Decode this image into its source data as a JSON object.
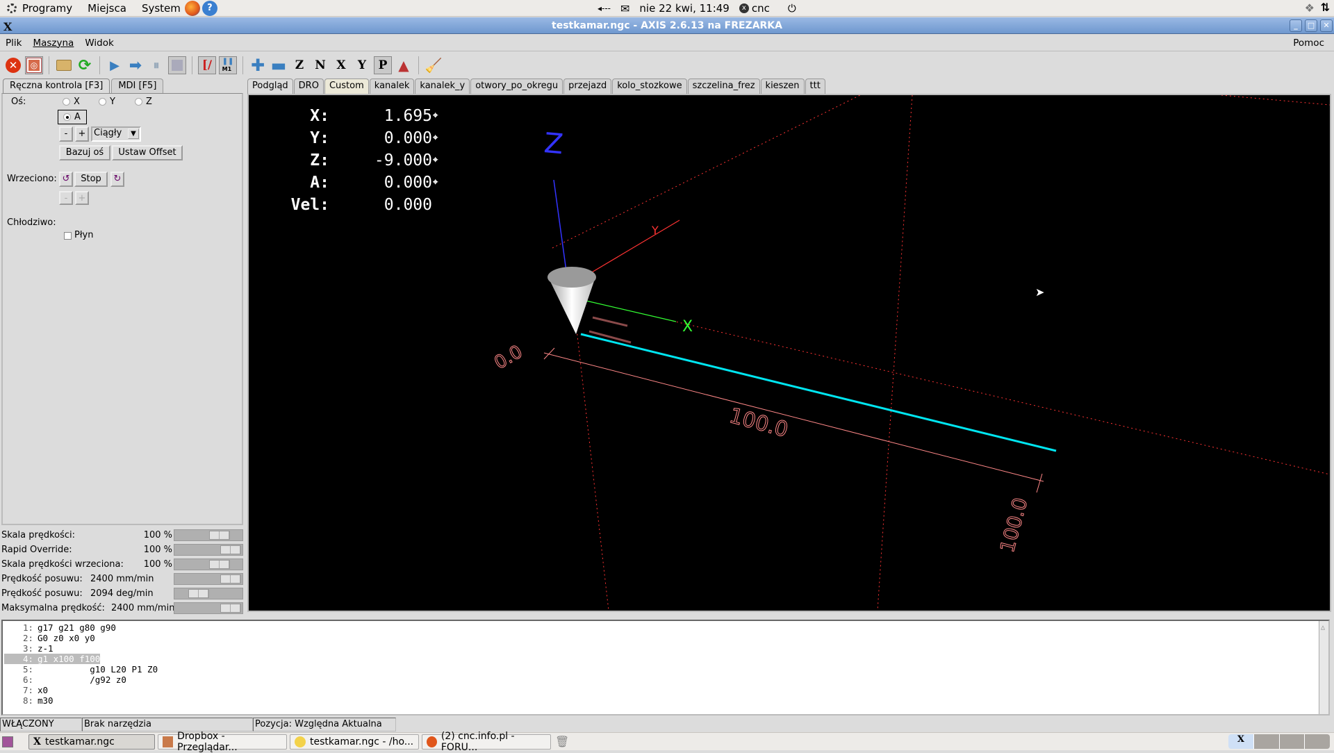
{
  "top_panel": {
    "menus": [
      "Programy",
      "Miejsca",
      "System"
    ],
    "clock": "nie 22 kwi, 11:49",
    "user": "cnc",
    "volume_indicator": "◂---"
  },
  "window": {
    "title": "testkamar.ngc - AXIS 2.6.13 na FREZARKA"
  },
  "menubar": {
    "items": [
      "Plik",
      "Maszyna",
      "Widok"
    ],
    "help": "Pomoc"
  },
  "toolbar": {
    "buttons": [
      "estop",
      "machine-power",
      "open-file",
      "reload-file",
      "run",
      "step",
      "pause",
      "stop",
      "block-delete",
      "optional-stop-m1",
      "zoom-in",
      "zoom-out",
      "view-z",
      "view-z-rotated",
      "view-x",
      "view-y",
      "view-perspective",
      "rotate-view",
      "clear-plot"
    ]
  },
  "left_tabs": [
    {
      "label": "Ręczna kontrola [F3]",
      "active": true
    },
    {
      "label": "MDI [F5]",
      "active": false
    }
  ],
  "manual": {
    "axis_label": "Oś:",
    "axes": [
      {
        "label": "X",
        "selected": false
      },
      {
        "label": "Y",
        "selected": false
      },
      {
        "label": "Z",
        "selected": false
      },
      {
        "label": "A",
        "selected": true
      }
    ],
    "jog_minus": "-",
    "jog_plus": "+",
    "jog_mode": "Ciągły",
    "home_button": "Bazuj oś",
    "offset_button": "Ustaw Offset",
    "spindle_label": "Wrzeciono:",
    "spindle_stop": "Stop",
    "spindle_minus": "-",
    "spindle_plus": "+",
    "coolant_label": "Chłodziwo:",
    "flood_label": "Płyn",
    "flood_checked": false
  },
  "sliders": [
    {
      "label": "Skala prędkości:",
      "value": "100 %",
      "fraction": 0.75
    },
    {
      "label": "Rapid Override:",
      "value": "100 %",
      "fraction": 1.0
    },
    {
      "label": "Skala prędkości wrzeciona:",
      "value": "100 %",
      "fraction": 0.75
    },
    {
      "label": "Prędkość posuwu:",
      "value": "2400 mm/min",
      "fraction": 1.0
    },
    {
      "label": "Prędkość posuwu:",
      "value": "2094 deg/min",
      "fraction": 0.3
    },
    {
      "label": "Maksymalna prędkość:",
      "value": "2400 mm/min",
      "fraction": 1.0
    }
  ],
  "view_tabs": [
    {
      "label": "Podgląd",
      "active": true
    },
    {
      "label": "DRO"
    },
    {
      "label": "Custom",
      "highlight": true
    },
    {
      "label": "kanalek"
    },
    {
      "label": "kanalek_y"
    },
    {
      "label": "otwory_po_okregu"
    },
    {
      "label": "przejazd"
    },
    {
      "label": "kolo_stozkowe"
    },
    {
      "label": "szczelina_frez"
    },
    {
      "label": "kieszen"
    },
    {
      "label": "ttt"
    }
  ],
  "dro": [
    {
      "axis": "X:",
      "value": "1.695",
      "homed": true
    },
    {
      "axis": "Y:",
      "value": "0.000",
      "homed": true
    },
    {
      "axis": "Z:",
      "value": "-9.000",
      "homed": true
    },
    {
      "axis": "A:",
      "value": "0.000",
      "homed": true
    },
    {
      "axis": "Vel:",
      "value": "0.000",
      "homed": false
    }
  ],
  "preview": {
    "axis_labels": {
      "x": "X",
      "y": "Y",
      "z": "Z"
    },
    "dimension_labels": [
      "0.0",
      "100.0",
      "100.0"
    ],
    "colors": {
      "toolpath_feed": "#00e5f0",
      "dims": "#ff8080",
      "x_axis": "#3f3",
      "y_axis": "#f33",
      "z_axis": "#33f"
    }
  },
  "gcode": [
    {
      "n": "1:",
      "text": "g17 g21 g80 g90"
    },
    {
      "n": "2:",
      "text": "G0 z0 x0 y0"
    },
    {
      "n": "3:",
      "text": "z-1"
    },
    {
      "n": "4:",
      "text": "g1 x100 f100",
      "selected": true
    },
    {
      "n": "5:",
      "text": "          g10 L20 P1 Z0"
    },
    {
      "n": "6:",
      "text": "          /g92 z0"
    },
    {
      "n": "7:",
      "text": "x0"
    },
    {
      "n": "8:",
      "text": "m30"
    }
  ],
  "status": {
    "state": "WŁĄCZONY",
    "tool": "Brak narzędzia",
    "position": "Pozycja: Względna Aktualna"
  },
  "taskbar": {
    "tasks": [
      {
        "label": "testkamar.ngc",
        "active": true
      },
      {
        "label": "Dropbox - Przeglądar..."
      },
      {
        "label": "testkamar.ngc - /ho..."
      },
      {
        "label": "(2) cnc.info.pl - FORU..."
      }
    ]
  }
}
